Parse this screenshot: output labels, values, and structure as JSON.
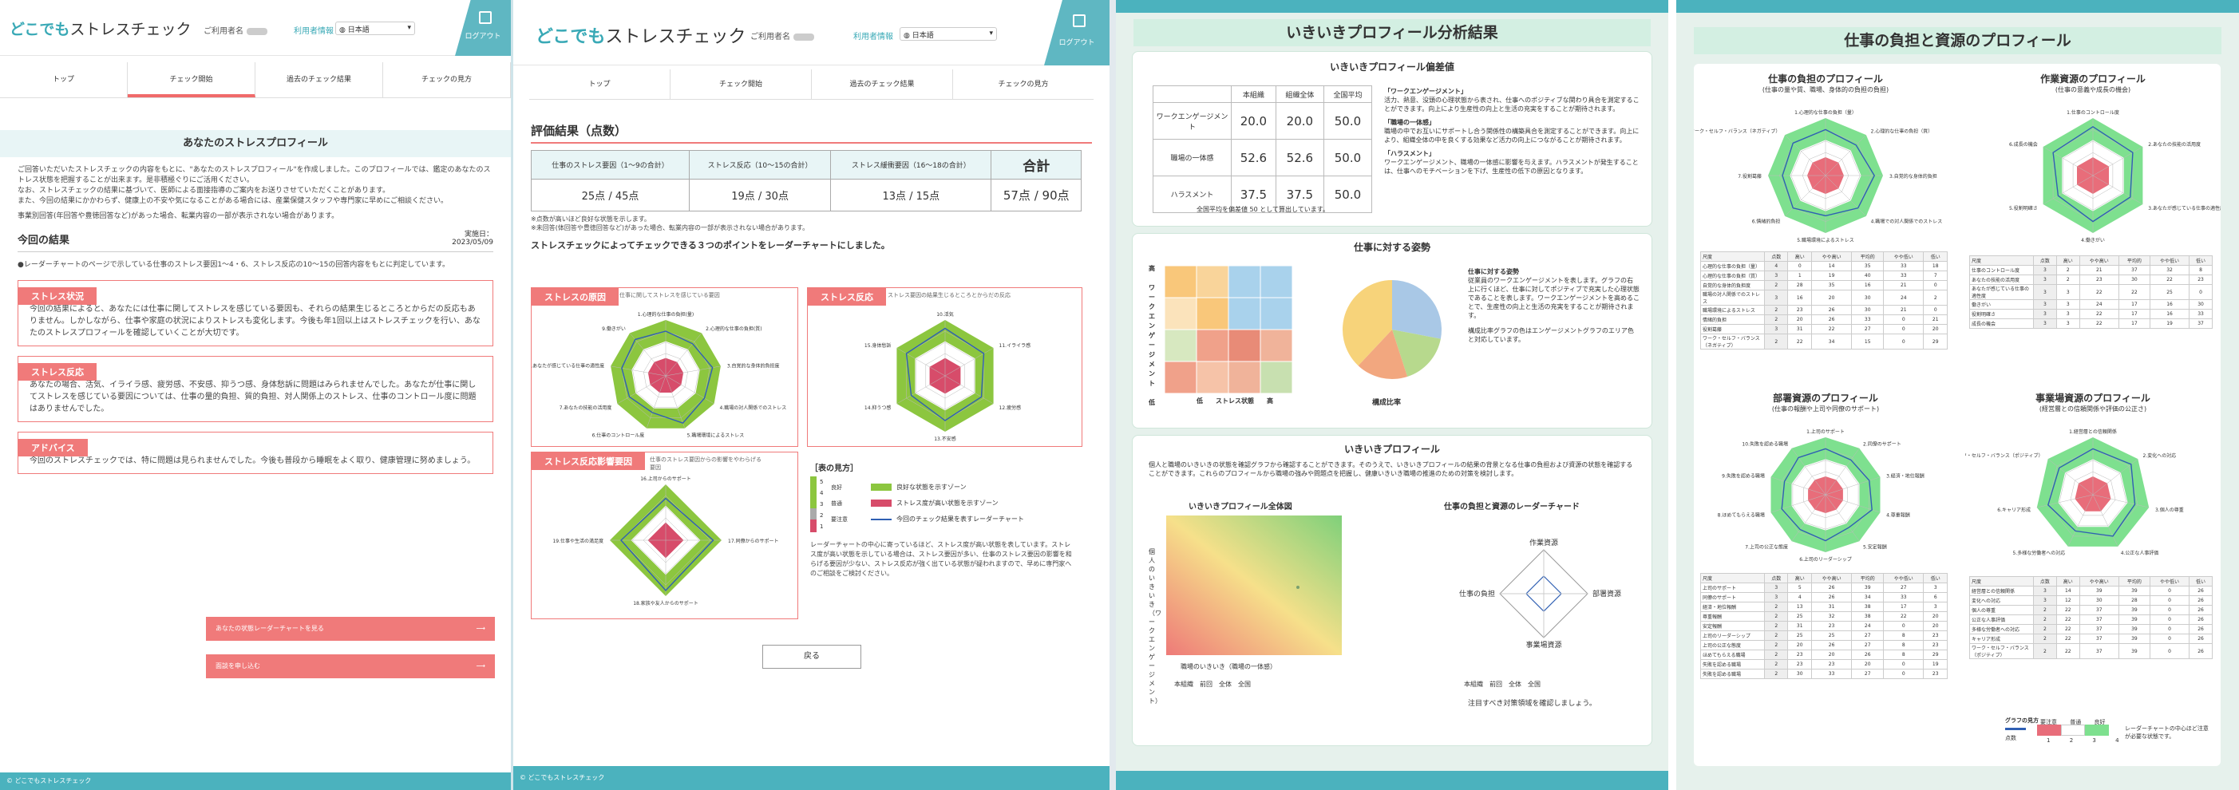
{
  "p1": {
    "logo_a": "どこでも",
    "logo_b": "ストレスチェック",
    "user_label": "ご利用者名",
    "user_info": "利用者情報",
    "lang": "日本語",
    "logout": "ログアウト",
    "nav": [
      "トップ",
      "チェック開始",
      "過去のチェック結果",
      "チェックの見方"
    ],
    "title": "あなたのストレスプロフィール",
    "intro": [
      "ご回答いただいたストレスチェックの内容をもとに、\"あなたのストレスプロフィール\"を作成しました。このプロフィールでは、鑑定のあなたのストレス状態を把握することが出来ます。是非積極ぐりにご活用ください。",
      "なお、ストレスチェックの結果に基づいて、医師による面接指導のご案内をお送りさせていただくことがあります。",
      "また、今回の結果にかかわらず、健康上の不安や気になることがある場合には、産業保健スタッフや専門家に早めにご相談ください。",
      "事業別回答(年回答や豊徳回答など)があった場合、転業内容の一部が表示されない場合があります。"
    ],
    "result_title": "今回の結果",
    "date_label": "実施日：",
    "date": "2023/05/09",
    "result_note": "●レーダーチャートのページで示している仕事のストレス要因1〜4・6、ストレス反応の10〜15の回答内容をもとに判定しています。",
    "box1_label": "ストレス状況",
    "box1_text": "今回の結果によると、あなたには仕事に関してストレスを感じている要因も、それらの結果生じるところとからだの反応もありません。しかしながら、仕事や家庭の状況によりストレスも変化します。今後も年1回以上はストレスチェックを行い、あなたのストレスプロフィールを確認していくことが大切です。",
    "box2_label": "ストレス反応",
    "box2_text": "あなたの場合、活気、イライラ感、疲労感、不安感、抑うつ感、身体愁訴に問題はみられませんでした。あなたが仕事に関してストレスを感じている要因については、仕事の量的負担、質的負担、対人関係上のストレス、仕事のコントロール度に問題はありませんでした。",
    "box3_label": "アドバイス",
    "box3_text": "今回のストレスチェックでは、特に問題は見られませんでした。今後も普段から睡眠をよく取り、健康管理に努めましょう。",
    "btn1": "あなたの状態レーダーチャートを見る",
    "btn2": "面談を申し込む",
    "footer": "© どこでもストレスチェック"
  },
  "p2": {
    "section": "評価結果（点数）",
    "headers": [
      "仕事のストレス要因（1〜9の合計）",
      "ストレス反応（10〜15の合計）",
      "ストレス緩衝要因（16〜18の合計）",
      "合計"
    ],
    "scores": [
      "25点 / 45点",
      "19点 / 30点",
      "13点 / 15点",
      "57点 / 90点"
    ],
    "notes": [
      "※点数が高いほど良好な状態を示します。",
      "※未回答(体回答や豊徳回答など)があった場合、転業内容の一部が表示されない場合があります。"
    ],
    "radar_intro": "ストレスチェックによってチェックできる３つのポイントをレーダーチャートにしました。",
    "r1_label": "ストレスの原因",
    "r1_desc": "仕事に関してストレスを感じている要因",
    "r1_axes": [
      "1.心理的な仕事の負担(量)",
      "2.心理的な仕事の負担(質)",
      "3.自覚的な身体的負担度",
      "4.職場の対人関係でのストレス",
      "5.職場環境によるストレス",
      "6.仕事のコントロール度",
      "7.あなたの技能の活用度",
      "8.あなたが感じている仕事の適性度",
      "9.働きがい"
    ],
    "r2_label": "ストレス反応",
    "r2_desc": "ストレス要因の結果生じるところとからだの反応",
    "r2_axes": [
      "10.活気",
      "11.イライラ感",
      "12.疲労感",
      "13.不安感",
      "14.抑うつ感",
      "15.身体愁訴"
    ],
    "r3_label": "ストレス反応影響要因",
    "r3_desc": "仕事のストレス要因からの影響をやわらげる要因",
    "r3_axes": [
      "16.上司からのサポート",
      "17.同僚からのサポート",
      "18.家族や友人からのサポート",
      "19.仕事や生活の満足度"
    ],
    "legend_title": "［表の見方］",
    "legend_levels": [
      "良好",
      "普通",
      "要注意"
    ],
    "legend_nums": [
      "5",
      "4",
      "3",
      "2",
      "1"
    ],
    "legend_items": [
      "良好な状態を示すゾーン",
      "ストレス度が高い状態を示すゾーン",
      "今回のチェック結果を表すレーダーチャート"
    ],
    "legend_text": "レーダーチャートの中心に寄っているほど、ストレス度が高い状態を表しています。ストレス度が高い状態を示している場合は、ストレス要因が多い、仕事のストレス要因の影響を和らげる要因が少ない、ストレス反応が強く出ている状態が疑われますので、早めに専門家へのご相談をご検討ください。",
    "back": "戻る",
    "footer": "© どこでもストレスチェック"
  },
  "p3": {
    "title": "いきいきプロフィール分析結果",
    "dev_title": "いきいきプロフィール偏差値",
    "cols": [
      "本組織",
      "組織全体",
      "全国平均"
    ],
    "rows": [
      {
        "name": "ワークエンゲージメント",
        "v": [
          "20.0",
          "20.0",
          "50.0"
        ]
      },
      {
        "name": "職場の一体感",
        "v": [
          "52.6",
          "52.6",
          "50.0"
        ]
      },
      {
        "name": "ハラスメント",
        "v": [
          "37.5",
          "37.5",
          "50.0"
        ]
      }
    ],
    "avg_note": "全国平均を偏差値 50 として算出しています。",
    "d1_t": "「ワークエンゲージメント」",
    "d1": "活力、熱意、没頭の心理状態から表され、仕事へのポジティブな関わり具合を測定することができます。向上により生産性の向上と生活の充実をすることが期待されます。",
    "d2_t": "「職場の一体感」",
    "d2": "職場の中でお互いにサポートし合う関係性の構築具合を測定することができます。向上により、組織全体の中を良くする効果など活力の向上につながることが期待されます。",
    "d3_t": "「ハラスメント」",
    "d3": "ワークエンゲージメント、職場の一体感に影響を与えます。ハラスメントが発生することは、仕事へのモチベーションを下げ、生産性の低下の原因となります。",
    "att_title": "仕事に対する姿勢",
    "att_ylabel": "ワークエンゲージメント",
    "att_xlabel": "ストレス状態",
    "att_hi": "高",
    "att_lo": "低",
    "pie_label": "構成比率",
    "att_t": "仕事に対する姿勢",
    "att_d": "従業員のワークエンゲージメントを表します。グラフの右上に行くほど、仕事に対してポジティブで充実した心理状態であることを表します。ワークエンゲージメントを高めることで、生産性の向上と生活の充実をすることが期待されます。",
    "att_d2": "構成比率グラフの色はエンゲージメントグラフのエリア色と対応しています。",
    "ip_title": "いきいきプロフィール",
    "ip_desc": "個人と職場のいきいきの状態を確認グラフから確認することができます。そのうえで、いきいきプロフィールの結果の背景となる仕事の負担および資源の状態を確認することができます。これらのプロフィールから職場の強みや問題点を把握し、健康いきいき職場の推進のための対策を検討します。",
    "ip_all": "いきいきプロフィール全体図",
    "ip_y": "個人のいきいき（ワークエンゲージメント）",
    "ip_x": "職場のいきいき（職場の一体感）",
    "ip_legend": [
      "本組織",
      "前回",
      "全体",
      "全国"
    ],
    "ip_radar": "仕事の負担と資源のレーダーチャード",
    "ip_axes": [
      "作業資源",
      "部署資源",
      "事業場資源",
      "仕事の負担"
    ],
    "ip_foot": "注目すべき対策領域を確認しましょう。"
  },
  "p4": {
    "title": "仕事の負担と資源のプロフィール",
    "c1": "仕事の負担のプロフィール",
    "c1s": "(仕事の量や質、職場、身体的の負担の負担)",
    "c1_axes": [
      "1.心理的な仕事の負担（量）",
      "2.心理的な仕事の負担（質）",
      "3.自覚的な身体的負担",
      "4.職場での対人関係でのストレス",
      "5.職場環境によるストレス",
      "6.情緒的負担",
      "7.役割葛藤",
      "6.ワーク・セルフ・バランス（ネガティブ）"
    ],
    "c2": "作業資源のプロフィール",
    "c2s": "(仕事の意義や成長の機会)",
    "c2_axes": [
      "1.仕事のコントロール度",
      "2.あなたの技能の活用度",
      "3.あなたが感じている仕事の適性度",
      "4.働きがい",
      "5.役割明確さ",
      "6.成長の機会"
    ],
    "c3": "部署資源のプロフィール",
    "c3s": "(仕事の報酬や上司や同僚のサポート)",
    "c3_axes": [
      "1.上司のサポート",
      "2.同僚のサポート",
      "3.経済・地位報酬",
      "4.尊重報酬",
      "5.安定報酬",
      "6.上司のリーダーシップ",
      "7.上司の公正な態度",
      "8.ほめてもらえる職場",
      "9.失敗を認める職場",
      "10.失敗を認める職場"
    ],
    "c4": "事業場資源のプロフィール",
    "c4s": "(経営層との信頼関係や評価の公正さ)",
    "c4_axes": [
      "1.経営層との信頼関係",
      "2.変化への対応",
      "3.個人の尊重",
      "4.公正な人事評価",
      "5.多様な労働者への対応",
      "6.キャリア形成",
      "7.ワーク・セルフ・バランス（ポジティブ）"
    ],
    "table_head": [
      "尺度",
      "点数",
      "高い",
      "やや高い",
      "平均的",
      "やや低い",
      "低い"
    ],
    "t1": [
      [
        "心理的な仕事の負担（量）",
        "4",
        "0",
        "14",
        "35",
        "33",
        "18"
      ],
      [
        "心理的な仕事の負担（質）",
        "3",
        "1",
        "19",
        "40",
        "33",
        "7"
      ],
      [
        "自覚的な身体的負担度",
        "2",
        "28",
        "35",
        "16",
        "21",
        "0"
      ],
      [
        "職場の対人関係でのストレス",
        "3",
        "16",
        "20",
        "30",
        "24",
        "2"
      ],
      [
        "職場環境によるストレス",
        "2",
        "23",
        "26",
        "30",
        "21",
        "0"
      ],
      [
        "情緒的負担",
        "2",
        "20",
        "26",
        "33",
        "0",
        "21"
      ],
      [
        "役割葛藤",
        "3",
        "31",
        "22",
        "27",
        "0",
        "20"
      ],
      [
        "ワーク・セルフ・バランス（ネガティブ）",
        "2",
        "22",
        "34",
        "15",
        "0",
        "29"
      ]
    ],
    "t2": [
      [
        "仕事のコントロール度",
        "3",
        "2",
        "21",
        "37",
        "32",
        "8"
      ],
      [
        "あなたの技能の活用度",
        "3",
        "2",
        "23",
        "30",
        "22",
        "23"
      ],
      [
        "あなたが感じている仕事の適性度",
        "3",
        "3",
        "22",
        "22",
        "25",
        "0"
      ],
      [
        "働きがい",
        "3",
        "3",
        "24",
        "17",
        "16",
        "30"
      ],
      [
        "役割明確さ",
        "3",
        "3",
        "22",
        "17",
        "16",
        "33"
      ],
      [
        "成長の機会",
        "3",
        "3",
        "22",
        "17",
        "19",
        "37"
      ]
    ],
    "t3": [
      [
        "上司のサポート",
        "3",
        "5",
        "26",
        "39",
        "27",
        "3"
      ],
      [
        "同僚のサポート",
        "3",
        "4",
        "26",
        "34",
        "33",
        "6"
      ],
      [
        "経済・地位報酬",
        "2",
        "13",
        "31",
        "38",
        "17",
        "3"
      ],
      [
        "尊重報酬",
        "2",
        "25",
        "32",
        "38",
        "22",
        "20"
      ],
      [
        "安定報酬",
        "2",
        "31",
        "23",
        "24",
        "0",
        "20"
      ],
      [
        "上司のリーダーシップ",
        "2",
        "25",
        "25",
        "27",
        "8",
        "23"
      ],
      [
        "上司の公正な態度",
        "2",
        "20",
        "26",
        "27",
        "8",
        "23"
      ],
      [
        "ほめてもらえる職場",
        "2",
        "23",
        "20",
        "26",
        "8",
        "29"
      ],
      [
        "失敗を認める職場",
        "2",
        "23",
        "23",
        "20",
        "0",
        "19"
      ],
      [
        "失敗を認める職場",
        "2",
        "30",
        "33",
        "27",
        "0",
        "23"
      ]
    ],
    "t4": [
      [
        "経営層との信頼関係",
        "3",
        "14",
        "39",
        "39",
        "0",
        "26"
      ],
      [
        "変化への対応",
        "3",
        "12",
        "30",
        "28",
        "0",
        "26"
      ],
      [
        "個人の尊重",
        "2",
        "22",
        "37",
        "39",
        "0",
        "26"
      ],
      [
        "公正な人事評価",
        "2",
        "22",
        "37",
        "39",
        "0",
        "26"
      ],
      [
        "多様な労働者への対応",
        "2",
        "22",
        "37",
        "39",
        "0",
        "26"
      ],
      [
        "キャリア形成",
        "2",
        "22",
        "37",
        "39",
        "0",
        "26"
      ],
      [
        "ワーク・セルフ・バランス（ポジティブ）",
        "2",
        "22",
        "37",
        "39",
        "0",
        "26"
      ]
    ],
    "legend_title": "グラフの見方",
    "legend_labels": [
      "要注意",
      "普通",
      "良好"
    ],
    "legend_nums": [
      "1",
      "2",
      "3",
      "4"
    ],
    "legend_text": "レーダーチャートの中心ほど注意が必要な状態です。",
    "legend_score": "点数"
  }
}
